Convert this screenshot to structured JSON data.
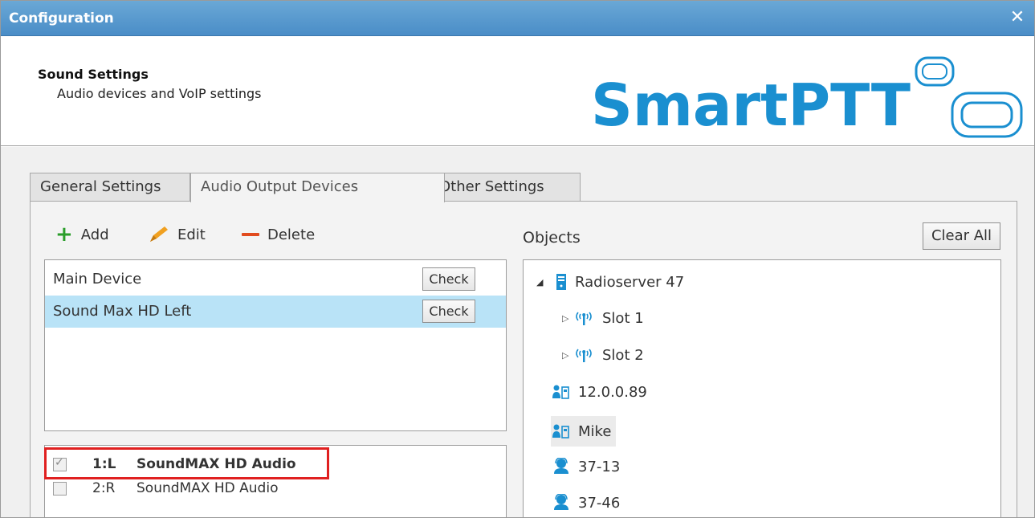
{
  "window": {
    "title": "Configuration",
    "close_glyph": "✕"
  },
  "header": {
    "title": "Sound Settings",
    "subtitle": "Audio devices and VoIP settings",
    "logo_text": "SmartPTT",
    "logo_color": "#1a8fd0"
  },
  "tabs": [
    {
      "label": "General Settings",
      "active": false
    },
    {
      "label": "Audio Output Devices",
      "active": true
    },
    {
      "label": "Other Settings",
      "active": false
    }
  ],
  "toolbar": {
    "add_label": "Add",
    "edit_label": "Edit",
    "delete_label": "Delete"
  },
  "devices": [
    {
      "label": "Main Device",
      "button": "Check",
      "selected": false
    },
    {
      "label": "Sound Max HD Left",
      "button": "Check",
      "selected": true
    }
  ],
  "channels": [
    {
      "id": "1:L",
      "name": "SoundMAX HD Audio",
      "checked": true,
      "highlighted": true
    },
    {
      "id": "2:R",
      "name": "SoundMAX HD Audio",
      "checked": false,
      "highlighted": false
    }
  ],
  "objects": {
    "label": "Objects",
    "clear_all_label": "Clear All",
    "tree": [
      {
        "label": "Radioserver 47",
        "icon": "server-icon",
        "expanded": true
      },
      {
        "label": "Slot 1",
        "icon": "antenna-icon",
        "expanded": false
      },
      {
        "label": "Slot 2",
        "icon": "antenna-icon",
        "expanded": false
      },
      {
        "label": "12.0.0.89",
        "icon": "radio-user-icon"
      },
      {
        "label": "Mike",
        "icon": "radio-user-icon",
        "hovered": true
      },
      {
        "label": "37-13",
        "icon": "talkgroup-icon"
      },
      {
        "label": "37-46",
        "icon": "talkgroup-icon"
      }
    ]
  },
  "colors": {
    "titlebar": "#4a8dc7",
    "selection": "#b9e3f7",
    "highlight_border": "#e02020",
    "add_green": "#2a9d2a",
    "edit_orange": "#f0a020",
    "delete_red": "#e14b1e",
    "icon_blue": "#1a8fd0"
  }
}
